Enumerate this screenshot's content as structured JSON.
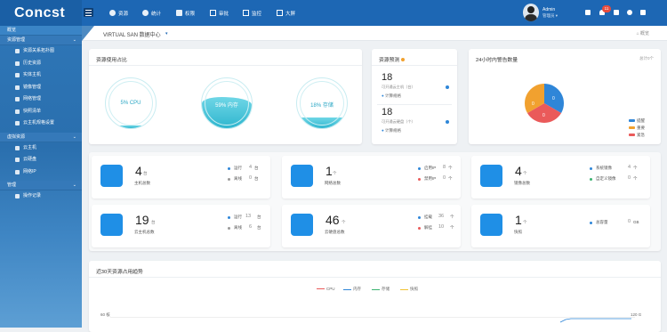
{
  "app": {
    "logo": "Concst"
  },
  "nav": [
    {
      "label": "资源",
      "icon": "cube-icon"
    },
    {
      "label": "统计",
      "icon": "chart-icon"
    },
    {
      "label": "权限",
      "icon": "key-icon"
    },
    {
      "label": "审批",
      "icon": "doc-icon"
    },
    {
      "label": "监控",
      "icon": "monitor-icon"
    },
    {
      "label": "大屏",
      "icon": "screen-icon"
    }
  ],
  "user": {
    "name": "Admin",
    "role": "管理员 ▾",
    "notifications": "11"
  },
  "sidebar": {
    "overview": "概览",
    "groups": [
      {
        "label": "资源管理",
        "items": [
          "资源关系拓扑图",
          "历史资源",
          "实体主机",
          "镜像管理",
          "网络管理",
          "快照清单",
          "云主机规格设置"
        ]
      },
      {
        "label": "虚拟资源",
        "items": [
          "云主机",
          "云硬盘",
          "网络IP"
        ]
      },
      {
        "label": "管理",
        "items": [
          "操作记录"
        ]
      }
    ]
  },
  "breadcrumb": {
    "title": "VIRTUAL SAN 数据中心",
    "home": "概览"
  },
  "usage": {
    "title": "资源使用占比",
    "gauges": [
      {
        "label": "5% CPU",
        "percent": 5
      },
      {
        "label": "59% 内存",
        "percent": 59
      },
      {
        "label": "18% 存储",
        "percent": 18
      }
    ]
  },
  "forecast": {
    "title": "资源预测",
    "items": [
      {
        "num": "18",
        "sub": "可开通云主机（台）",
        "link": "计算规格"
      },
      {
        "num": "18",
        "sub": "可开通云硬盘（个）",
        "link": "计算规格"
      }
    ]
  },
  "alarm": {
    "title": "24小时内警告数量",
    "total": "总计0个",
    "legend": [
      {
        "label": "提醒",
        "color": "#2f86d8"
      },
      {
        "label": "重要",
        "color": "#f1a12f"
      },
      {
        "label": "紧急",
        "color": "#ea5a5a"
      }
    ],
    "chart_data": {
      "type": "pie",
      "categories": [
        "提醒",
        "重要",
        "紧急"
      ],
      "values": [
        0,
        0,
        0
      ],
      "slice_labels": [
        "0",
        "0",
        "0"
      ]
    }
  },
  "stats": [
    {
      "num": "4",
      "unit": "台",
      "label": "主机总数",
      "rows": [
        {
          "label": "运行",
          "val": "4",
          "unit": "台",
          "color": "#2f86d8"
        },
        {
          "label": "离线",
          "val": "0",
          "unit": "台",
          "color": "#999"
        }
      ],
      "icon": "server-icon"
    },
    {
      "num": "1",
      "unit": "个",
      "label": "网络总数",
      "rows": [
        {
          "label": "启用IP",
          "val": "8",
          "unit": "个",
          "color": "#2f86d8"
        },
        {
          "label": "禁用IP",
          "val": "0",
          "unit": "个",
          "color": "#ea5a5a"
        }
      ],
      "icon": "globe-icon"
    },
    {
      "num": "4",
      "unit": "个",
      "label": "镜像总数",
      "rows": [
        {
          "label": "系统镜像",
          "val": "4",
          "unit": "个",
          "color": "#2f86d8"
        },
        {
          "label": "自定义镜像",
          "val": "0",
          "unit": "个",
          "color": "#3cb371"
        }
      ],
      "icon": "image-icon"
    },
    {
      "num": "19",
      "unit": "台",
      "label": "云主机总数",
      "rows": [
        {
          "label": "运行",
          "val": "13",
          "unit": "台",
          "color": "#2f86d8"
        },
        {
          "label": "离线",
          "val": "6",
          "unit": "台",
          "color": "#999"
        }
      ],
      "icon": "vm-icon"
    },
    {
      "num": "46",
      "unit": "个",
      "label": "云硬盘总数",
      "rows": [
        {
          "label": "挂载",
          "val": "36",
          "unit": "个",
          "color": "#2f86d8"
        },
        {
          "label": "解挂",
          "val": "10",
          "unit": "个",
          "color": "#ea5a5a"
        }
      ],
      "icon": "disk-icon"
    },
    {
      "num": "1",
      "unit": "个",
      "label": "快照",
      "rows": [
        {
          "label": "总容量",
          "val": "0",
          "unit": "GB",
          "color": "#2f86d8"
        }
      ],
      "icon": "snapshot-icon"
    }
  ],
  "trend": {
    "title": "近30天资源占用趋势",
    "left_axis": "60 核",
    "right_axis": "120 G",
    "legend": [
      {
        "label": "CPU",
        "color": "#ea5a5a"
      },
      {
        "label": "内存",
        "color": "#2f86d8"
      },
      {
        "label": "存储",
        "color": "#3cb371"
      },
      {
        "label": "快照",
        "color": "#f1c232"
      }
    ]
  }
}
